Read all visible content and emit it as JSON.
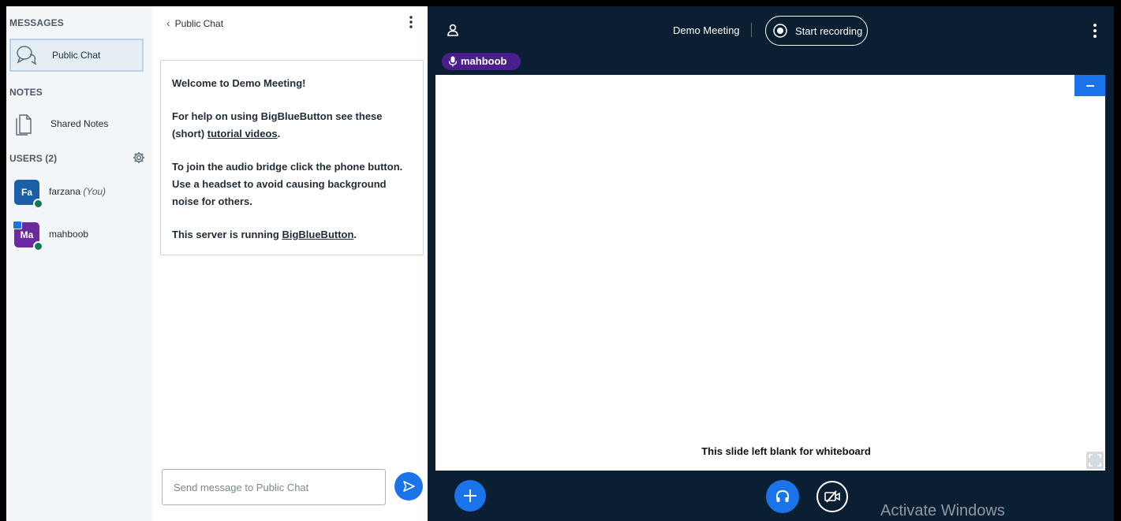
{
  "sidebar": {
    "messages_title": "MESSAGES",
    "public_chat_label": "Public Chat",
    "notes_title": "NOTES",
    "shared_notes_label": "Shared Notes",
    "users_title": "USERS (2)",
    "users": [
      {
        "initials": "Fa",
        "name": "farzana",
        "you_tag": "(You)",
        "color": "#1b5fa6"
      },
      {
        "initials": "Ma",
        "name": "mahboob",
        "you_tag": "",
        "color": "#6b2aa0"
      }
    ]
  },
  "chat": {
    "header": "Public Chat",
    "welcome_title": "Welcome to Demo Meeting!",
    "help_prefix": "For help on using BigBlueButton see these (short) ",
    "help_link": "tutorial videos",
    "help_suffix": ".",
    "audio_text": "To join the audio bridge click the phone button. Use a headset to avoid causing background noise for others.",
    "server_prefix": "This server is running ",
    "server_link": "BigBlueButton",
    "server_suffix": ".",
    "input_placeholder": "Send message to Public Chat"
  },
  "meeting": {
    "title": "Demo Meeting",
    "record_label": "Start recording",
    "talking_user": "mahboob",
    "slide_text": "This slide left blank for whiteboard",
    "watermark": "Activate Windows"
  },
  "colors": {
    "accent": "#1a73e8",
    "navbar_bg": "#0b1f33",
    "talker_bg": "#4a1f8c",
    "voice_green": "#0f7a55"
  }
}
